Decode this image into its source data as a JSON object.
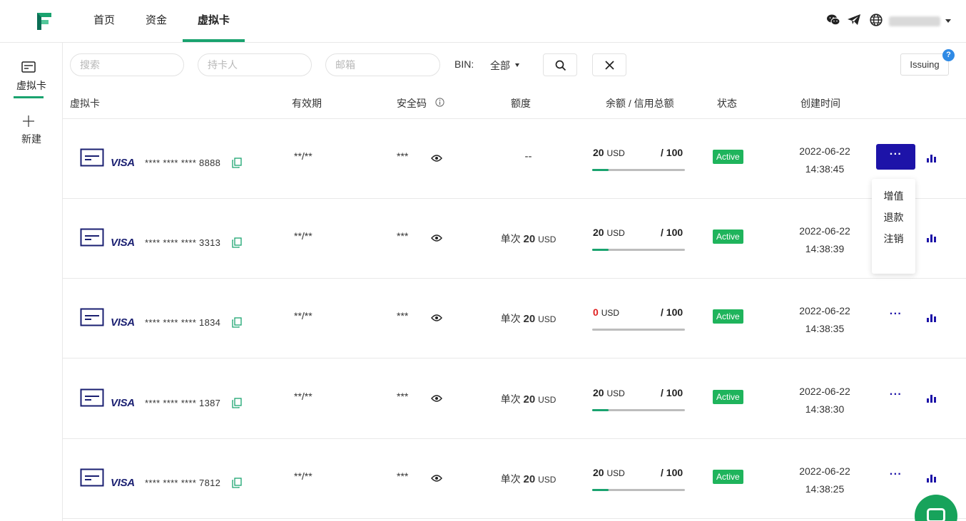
{
  "nav": {
    "items": [
      {
        "label": "首页"
      },
      {
        "label": "资金"
      },
      {
        "label": "虚拟卡"
      }
    ],
    "active": "虚拟卡",
    "icons": [
      "wechat-icon",
      "telegram-icon",
      "globe-icon"
    ]
  },
  "sidebar": {
    "items": [
      {
        "label": "虚拟卡",
        "icon": "card-icon"
      },
      {
        "label": "新建",
        "icon": "plus-icon"
      }
    ]
  },
  "filters": {
    "search_placeholder": "搜索",
    "holder_placeholder": "持卡人",
    "email_placeholder": "邮箱",
    "bin_label": "BIN:",
    "bin_value": "全部",
    "issuing_label": "Issuing",
    "help_label": "?"
  },
  "table": {
    "headers": {
      "card": "虚拟卡",
      "expiry": "有效期",
      "cvv": "安全码",
      "limit": "额度",
      "balance": "余额 / 信用总额",
      "status": "状态",
      "created": "创建时间"
    },
    "rows": [
      {
        "brand": "VISA",
        "number": "**** **** **** 8888",
        "expiry": "**/**",
        "cvv": "***",
        "limit_prefix": "",
        "limit_amount": "--",
        "limit_unit": "",
        "balance": "20",
        "balance_unit": "USD",
        "total": "/ 100",
        "progress": 0.18,
        "status": "Active",
        "date": "2022-06-22",
        "time": "14:38:45",
        "menu_label": "···"
      },
      {
        "brand": "VISA",
        "number": "**** **** **** 3313",
        "expiry": "**/**",
        "cvv": "***",
        "limit_prefix": "单次",
        "limit_amount": "20",
        "limit_unit": "USD",
        "balance": "20",
        "balance_unit": "USD",
        "total": "/ 100",
        "progress": 0.18,
        "status": "Active",
        "date": "2022-06-22",
        "time": "14:38:39",
        "menu_label": "···"
      },
      {
        "brand": "VISA",
        "number": "**** **** **** 1834",
        "expiry": "**/**",
        "cvv": "***",
        "limit_prefix": "单次",
        "limit_amount": "20",
        "limit_unit": "USD",
        "balance": "0",
        "balance_unit": "USD",
        "total": "/ 100",
        "progress": 0,
        "status": "Active",
        "date": "2022-06-22",
        "time": "14:38:35",
        "menu_label": "···"
      },
      {
        "brand": "VISA",
        "number": "**** **** **** 1387",
        "expiry": "**/**",
        "cvv": "***",
        "limit_prefix": "单次",
        "limit_amount": "20",
        "limit_unit": "USD",
        "balance": "20",
        "balance_unit": "USD",
        "total": "/ 100",
        "progress": 0.18,
        "status": "Active",
        "date": "2022-06-22",
        "time": "14:38:30",
        "menu_label": "···"
      },
      {
        "brand": "VISA",
        "number": "**** **** **** 7812",
        "expiry": "**/**",
        "cvv": "***",
        "limit_prefix": "单次",
        "limit_amount": "20",
        "limit_unit": "USD",
        "balance": "20",
        "balance_unit": "USD",
        "total": "/ 100",
        "progress": 0.18,
        "status": "Active",
        "date": "2022-06-22",
        "time": "14:38:25",
        "menu_label": "···"
      }
    ]
  },
  "dropdown": {
    "items": [
      "增值",
      "退款",
      "注销"
    ]
  },
  "colors": {
    "brand_green": "#1aa36f",
    "active_status": "#1fb45c",
    "menu_active": "#1d13a8",
    "visa_blue": "#1a1f71",
    "negative": "#e02020"
  }
}
